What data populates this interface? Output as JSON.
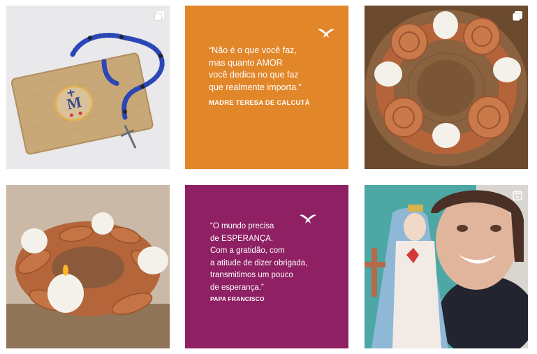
{
  "grid": {
    "posts": [
      {
        "kind": "photo",
        "subject": "rosary-pouch",
        "badge": "carousel-icon"
      },
      {
        "kind": "quote",
        "background": "#E2862A",
        "quote": "“Não é o que você faz,\nmas quanto AMOR\nvocê dedica no que faz\nque realmente importa.”",
        "author": "MADRE TERESA DE CALCUTÁ",
        "icon": "dove-icon"
      },
      {
        "kind": "photo",
        "subject": "clay-advent-wreath-roses",
        "badge": "carousel-icon"
      },
      {
        "kind": "photo",
        "subject": "clay-advent-wreath-leaves"
      },
      {
        "kind": "quote",
        "background": "#8E2063",
        "quote": "“O mundo precisa\nde ESPERANÇA.\nCom a gratidão, com\na atitude de dizer obrigada,\ntransmitimos um pouco\nde esperança.”",
        "author": "PAPA FRANCISCO",
        "icon": "dove-icon"
      },
      {
        "kind": "photo",
        "subject": "woman-with-mary-statue",
        "badge": "reels-icon"
      }
    ]
  },
  "colors": {
    "orange": "#E2862A",
    "purple": "#8E2063"
  }
}
